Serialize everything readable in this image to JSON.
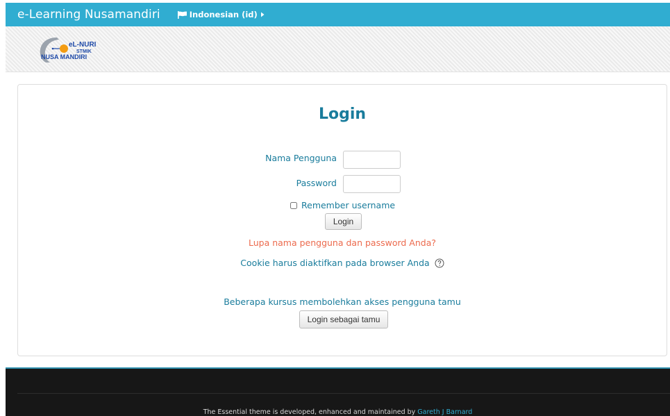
{
  "navbar": {
    "brand": "e-Learning Nusamandiri",
    "language": "Indonesian (id)",
    "flag_icon": "flag-icon",
    "caret_icon": "caret-right-icon"
  },
  "logo": {
    "line1": "eL-NURI",
    "line2": "STMIK",
    "line3": "NUSA MANDIRI"
  },
  "login": {
    "title": "Login",
    "username_label": "Nama Pengguna",
    "username_value": "",
    "password_label": "Password",
    "password_value": "",
    "remember_label": "Remember username",
    "remember_checked": false,
    "submit_label": "Login",
    "forgot_link": "Lupa nama pengguna dan password Anda?",
    "cookie_text": "Cookie harus diaktifkan pada browser Anda",
    "help_icon": "question-circle-icon",
    "guest_text": "Beberapa kursus membolehkan akses pengguna tamu",
    "guest_button": "Login sebagai tamu"
  },
  "footer": {
    "credit_text": "The Essential theme is developed, enhanced and maintained by ",
    "credit_link": "Gareth J Barnard"
  },
  "colors": {
    "navbar": "#30add1",
    "title": "#197c9c",
    "forgot_link": "#ec6a4d",
    "footer": "#171717"
  }
}
